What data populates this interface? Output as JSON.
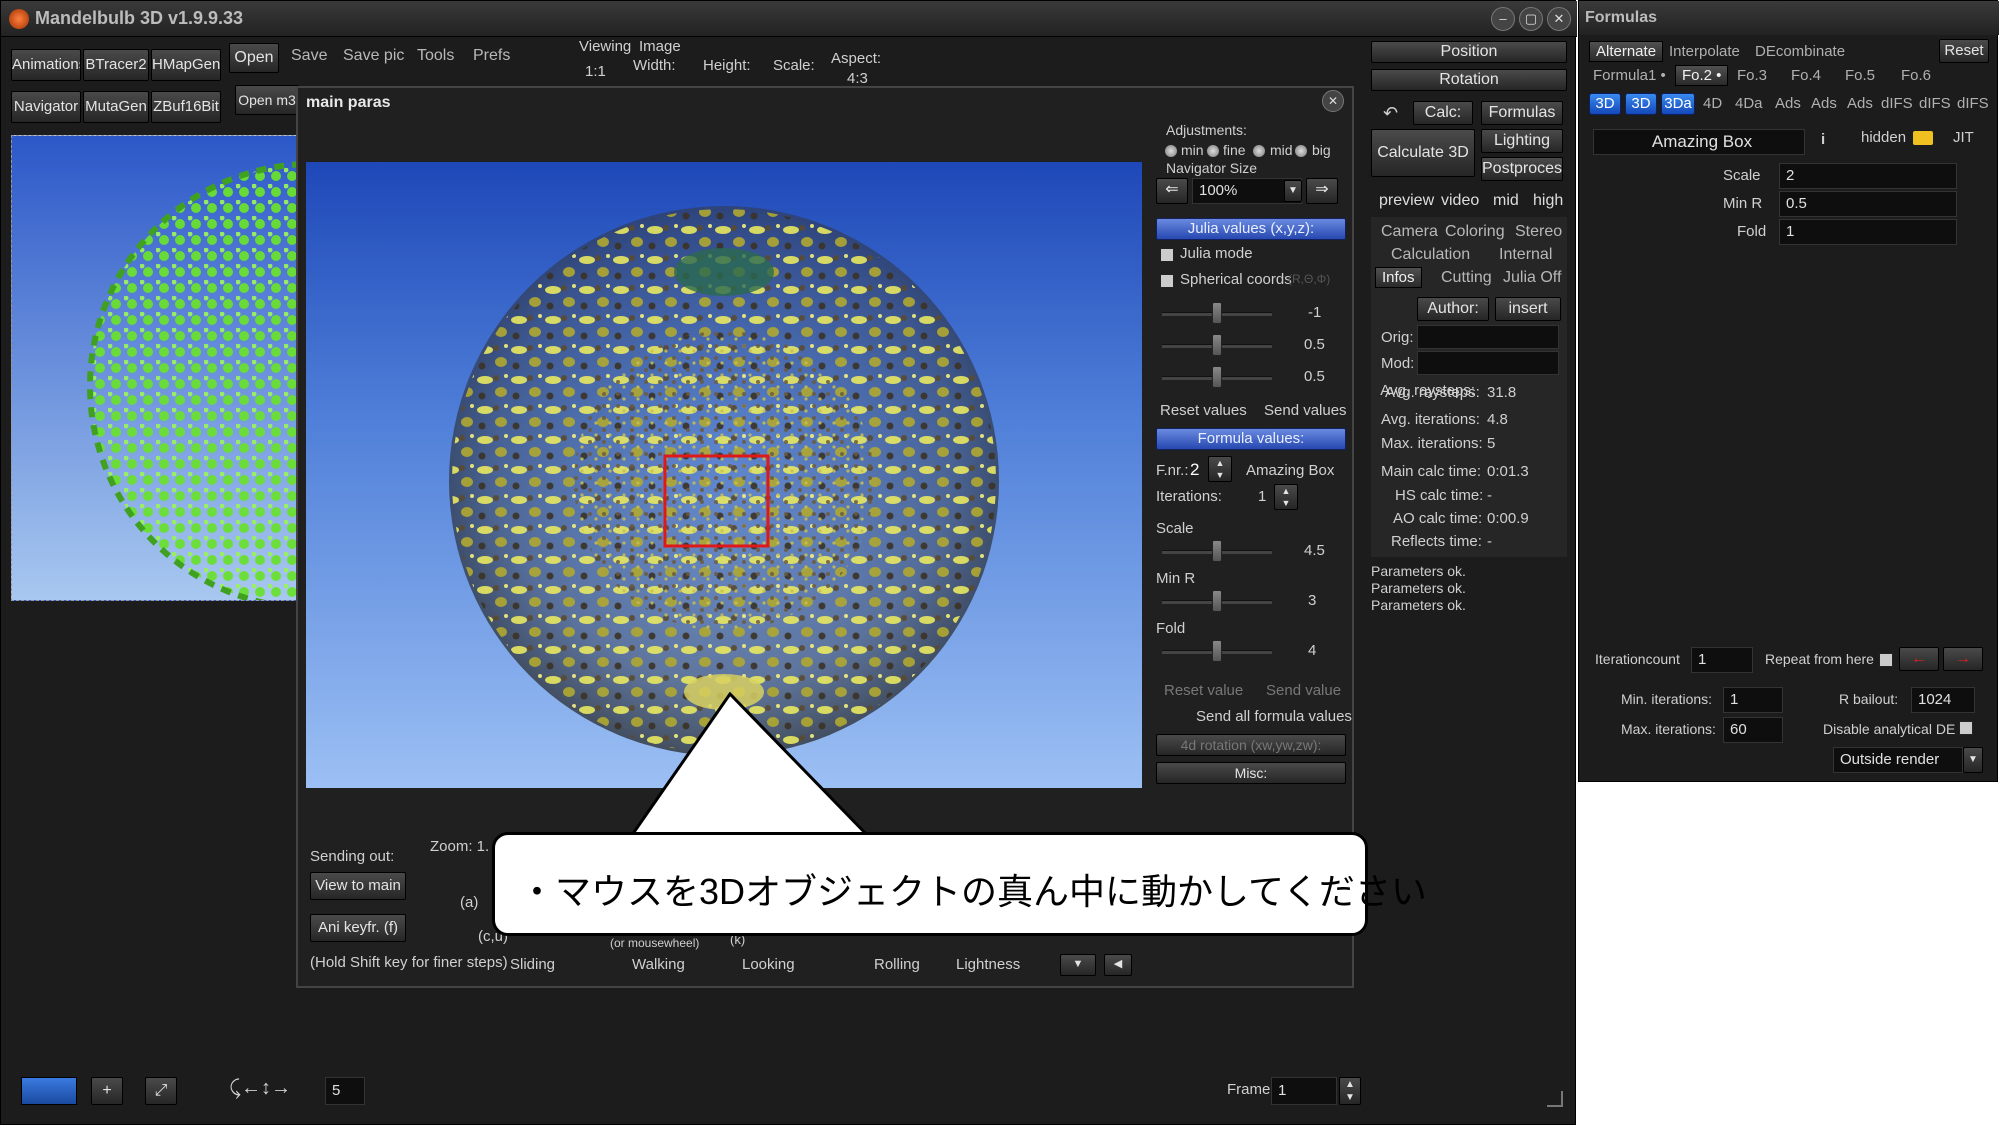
{
  "app": {
    "title": "Mandelbulb 3D   v1.9.9.33",
    "window_controls": [
      "–",
      "▢",
      "✕"
    ]
  },
  "toolbar": {
    "row1": [
      "Animations",
      "BTracer2",
      "HMapGen"
    ],
    "row2": [
      "Navigator",
      "MutaGen",
      "ZBuf16Bit"
    ],
    "open_label": "Open",
    "open_m3_label": "Open m3",
    "menu": [
      "Save",
      "Save pic",
      "Tools",
      "Prefs"
    ],
    "viewing_label": "Viewing",
    "viewing_value": "1:1",
    "image_label": "Image",
    "width_label": "Width:",
    "height_label": "Height:",
    "scale_label": "Scale:",
    "aspect_label": "Aspect:",
    "aspect_value": "4:3"
  },
  "right_panel": {
    "position": "Position",
    "rotation": "Rotation",
    "calc": "Calc:",
    "formulas": "Formulas",
    "calculate_3d": "Calculate 3D",
    "lighting": "Lighting",
    "postprocess": "Postprocess",
    "quality": [
      "preview",
      "video",
      "mid",
      "high"
    ],
    "tabs_row1": [
      "Camera",
      "Coloring",
      "Stereo"
    ],
    "tabs_row2": [
      "Calculation",
      "Internal"
    ],
    "tabs_row3": [
      "Infos",
      "Cutting",
      "Julia Off"
    ],
    "author": "Author:",
    "insert": "insert",
    "orig": "Orig:",
    "mod": "Mod:",
    "stats": [
      {
        "label": "Avg. raysteps:",
        "value": "31.8"
      },
      {
        "label": "Avg. iterations:",
        "value": "4.8"
      },
      {
        "label": "Max. iterations:",
        "value": "5"
      },
      {
        "label": "Main calc time:",
        "value": "0:01.3"
      },
      {
        "label": "HS calc time:",
        "value": "-"
      },
      {
        "label": "AO calc time:",
        "value": "0:00.9"
      },
      {
        "label": "Reflects time:",
        "value": "-"
      }
    ],
    "log": [
      "Parameters ok.",
      "Parameters ok.",
      "Parameters ok."
    ]
  },
  "dialog": {
    "title": "main paras",
    "adjustments": "Adjustments:",
    "adj_options": [
      "min",
      "fine",
      "mid",
      "big"
    ],
    "navigator_size": "Navigator Size",
    "navigator_value": "100%",
    "julia_values": "Julia values (x,y,z):",
    "julia_mode": "Julia mode",
    "spherical_coords": "Spherical coords",
    "spherical_hint": "(R,Θ,Φ)",
    "julia_sliders": [
      "-1",
      "0.5",
      "0.5"
    ],
    "reset_values": "Reset values",
    "send_values": "Send values",
    "formula_values": "Formula values:",
    "fnr_label": "F.nr.:",
    "fnr_value": "2",
    "formula_name": "Amazing Box",
    "iterations_label": "Iterations:",
    "iterations_value": "1",
    "params": [
      {
        "name": "Scale",
        "value": "4.5"
      },
      {
        "name": "Min R",
        "value": "3"
      },
      {
        "name": "Fold",
        "value": "4"
      }
    ],
    "reset_value": "Reset value",
    "send_value": "Send value",
    "send_all": "Send all formula values",
    "rotation_4d": "4d rotation (xw,yw,zw):",
    "misc": "Misc:",
    "sending_out": "Sending out:",
    "view_to_main": "View to main",
    "ani_keyfr": "Ani keyfr. (f)",
    "zoom_label": "Zoom: 1.",
    "a_label": "(a)",
    "cu_label": "(c,u)",
    "mousewheel": "(or mousewheel)",
    "k_label": "(k)",
    "hold_shift": "(Hold Shift key for finer steps)",
    "modes": [
      "Sliding",
      "Walking",
      "Looking",
      "Rolling",
      "Lightness"
    ]
  },
  "status": {
    "step_value": "5",
    "frame_label": "Frame:",
    "frame_value": "1"
  },
  "formulas_window": {
    "title": "Formulas",
    "tabs_top": [
      "Alternate",
      "Interpolate",
      "DEcombinate"
    ],
    "reset": "Reset",
    "formula_tabs": [
      "Formula1 •",
      "Fo.2 •",
      "Fo.3",
      "Fo.4",
      "Fo.5",
      "Fo.6"
    ],
    "type_buttons": [
      "3D",
      "3D",
      "3Da",
      "4D",
      "4Da",
      "Ads",
      "Ads",
      "Ads",
      "dIFS",
      "dIFS",
      "dIFS"
    ],
    "formula_name": "Amazing Box",
    "info": "i",
    "hidden": "hidden",
    "jit": "JIT",
    "params": [
      {
        "name": "Scale",
        "value": "2"
      },
      {
        "name": "Min R",
        "value": "0.5"
      },
      {
        "name": "Fold",
        "value": "1"
      }
    ],
    "iterationcount_label": "Iterationcount",
    "iterationcount_value": "1",
    "repeat_from_here": "Repeat from here",
    "min_iterations_label": "Min. iterations:",
    "min_iterations_value": "1",
    "rbailout_label": "R bailout:",
    "rbailout_value": "1024",
    "max_iterations_label": "Max. iterations:",
    "max_iterations_value": "60",
    "disable_de": "Disable analytical DE",
    "outside_render": "Outside render"
  },
  "callout": {
    "text": "・マウスを3Dオブジェクトの真ん中に動かしてください"
  },
  "colors": {
    "highlight_box": "#e01818",
    "accent_blue": "#2e6ee0"
  }
}
